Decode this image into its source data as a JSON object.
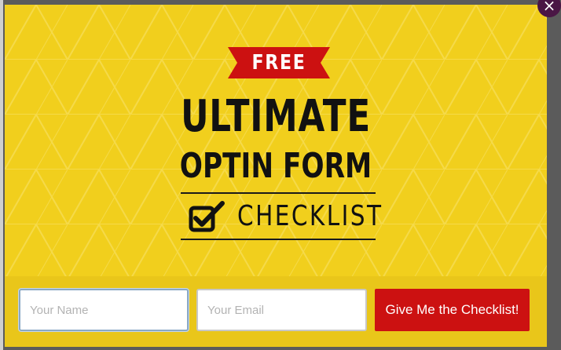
{
  "popup": {
    "badge": "FREE",
    "title_line1": "ULTIMATE",
    "title_line2": "OPTIN FORM",
    "subtitle": "CHECKLIST",
    "close_label": "×"
  },
  "form": {
    "name_placeholder": "Your Name",
    "email_placeholder": "Your Email",
    "submit_label": "Give Me the Checklist!"
  },
  "colors": {
    "background": "#f1cf1d",
    "banner": "#cc1111",
    "button": "#cc1111",
    "close": "#4a1645"
  },
  "icons": {
    "close": "close-icon",
    "check": "checkbox-check-icon"
  }
}
